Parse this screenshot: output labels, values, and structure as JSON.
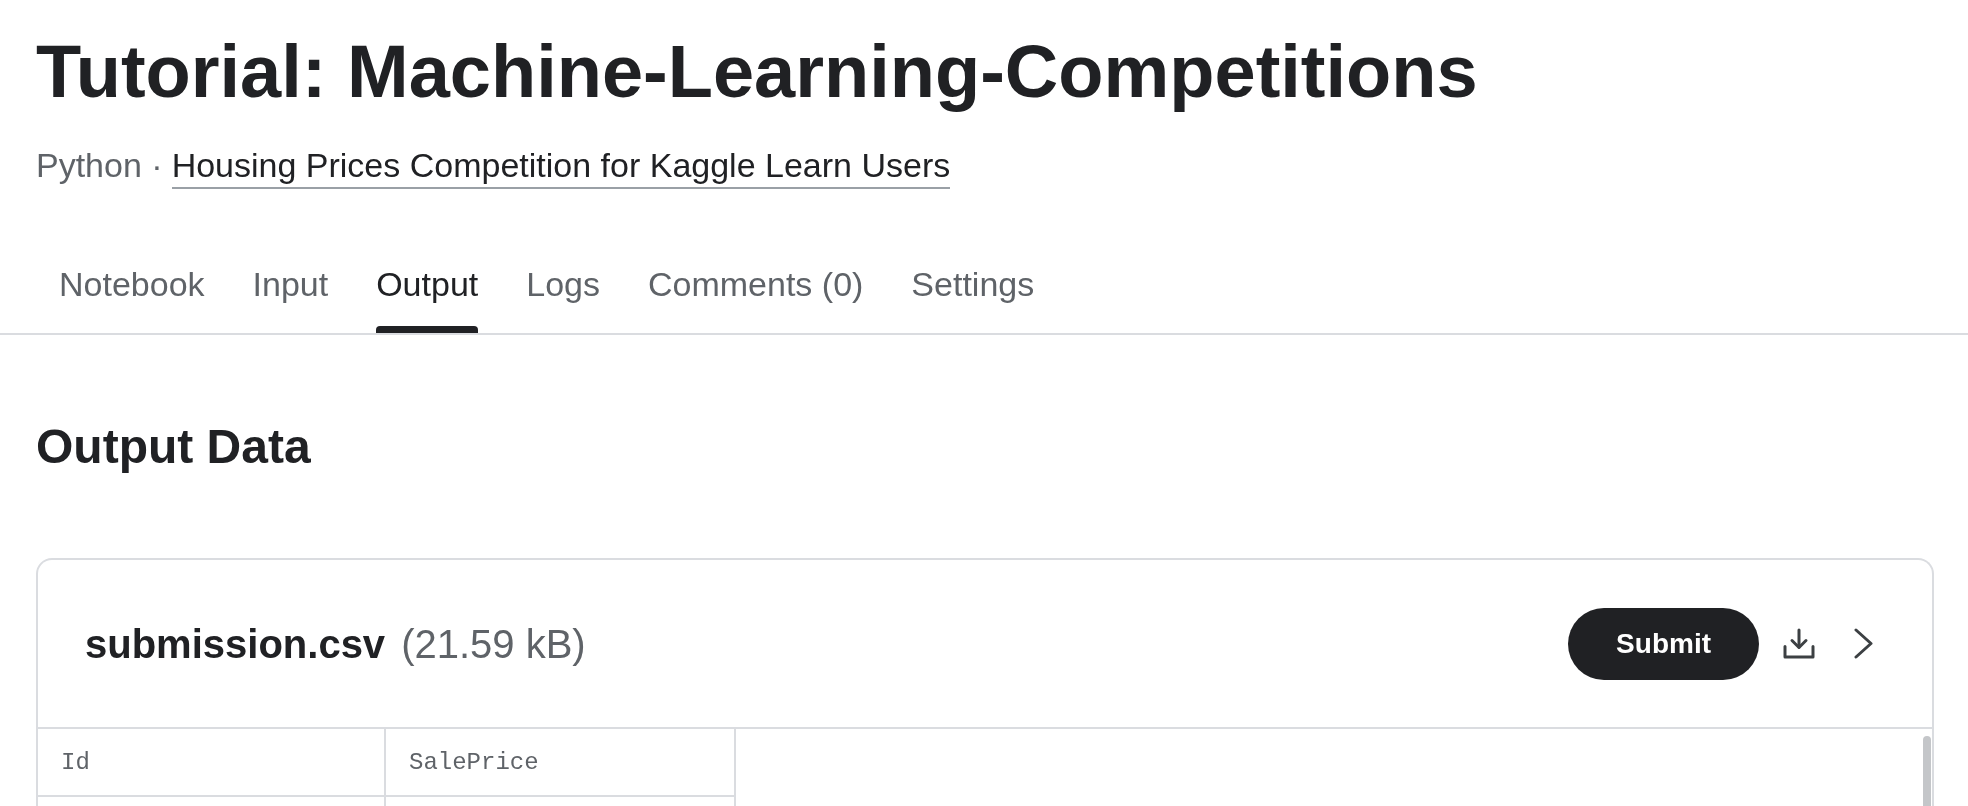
{
  "page": {
    "title": "Tutorial: Machine-Learning-Competitions",
    "language": "Python",
    "separator": "·",
    "competition_link": "Housing Prices Competition for Kaggle Learn Users"
  },
  "tabs": [
    {
      "label": "Notebook",
      "selected": false
    },
    {
      "label": "Input",
      "selected": false
    },
    {
      "label": "Output",
      "selected": true
    },
    {
      "label": "Logs",
      "selected": false
    },
    {
      "label": "Comments (0)",
      "selected": false
    },
    {
      "label": "Settings",
      "selected": false
    }
  ],
  "section": {
    "heading": "Output Data"
  },
  "file_card": {
    "filename": "submission.csv",
    "size": "(21.59 kB)",
    "submit_button": "Submit",
    "table": {
      "columns": [
        "Id",
        "SalePrice"
      ]
    }
  }
}
